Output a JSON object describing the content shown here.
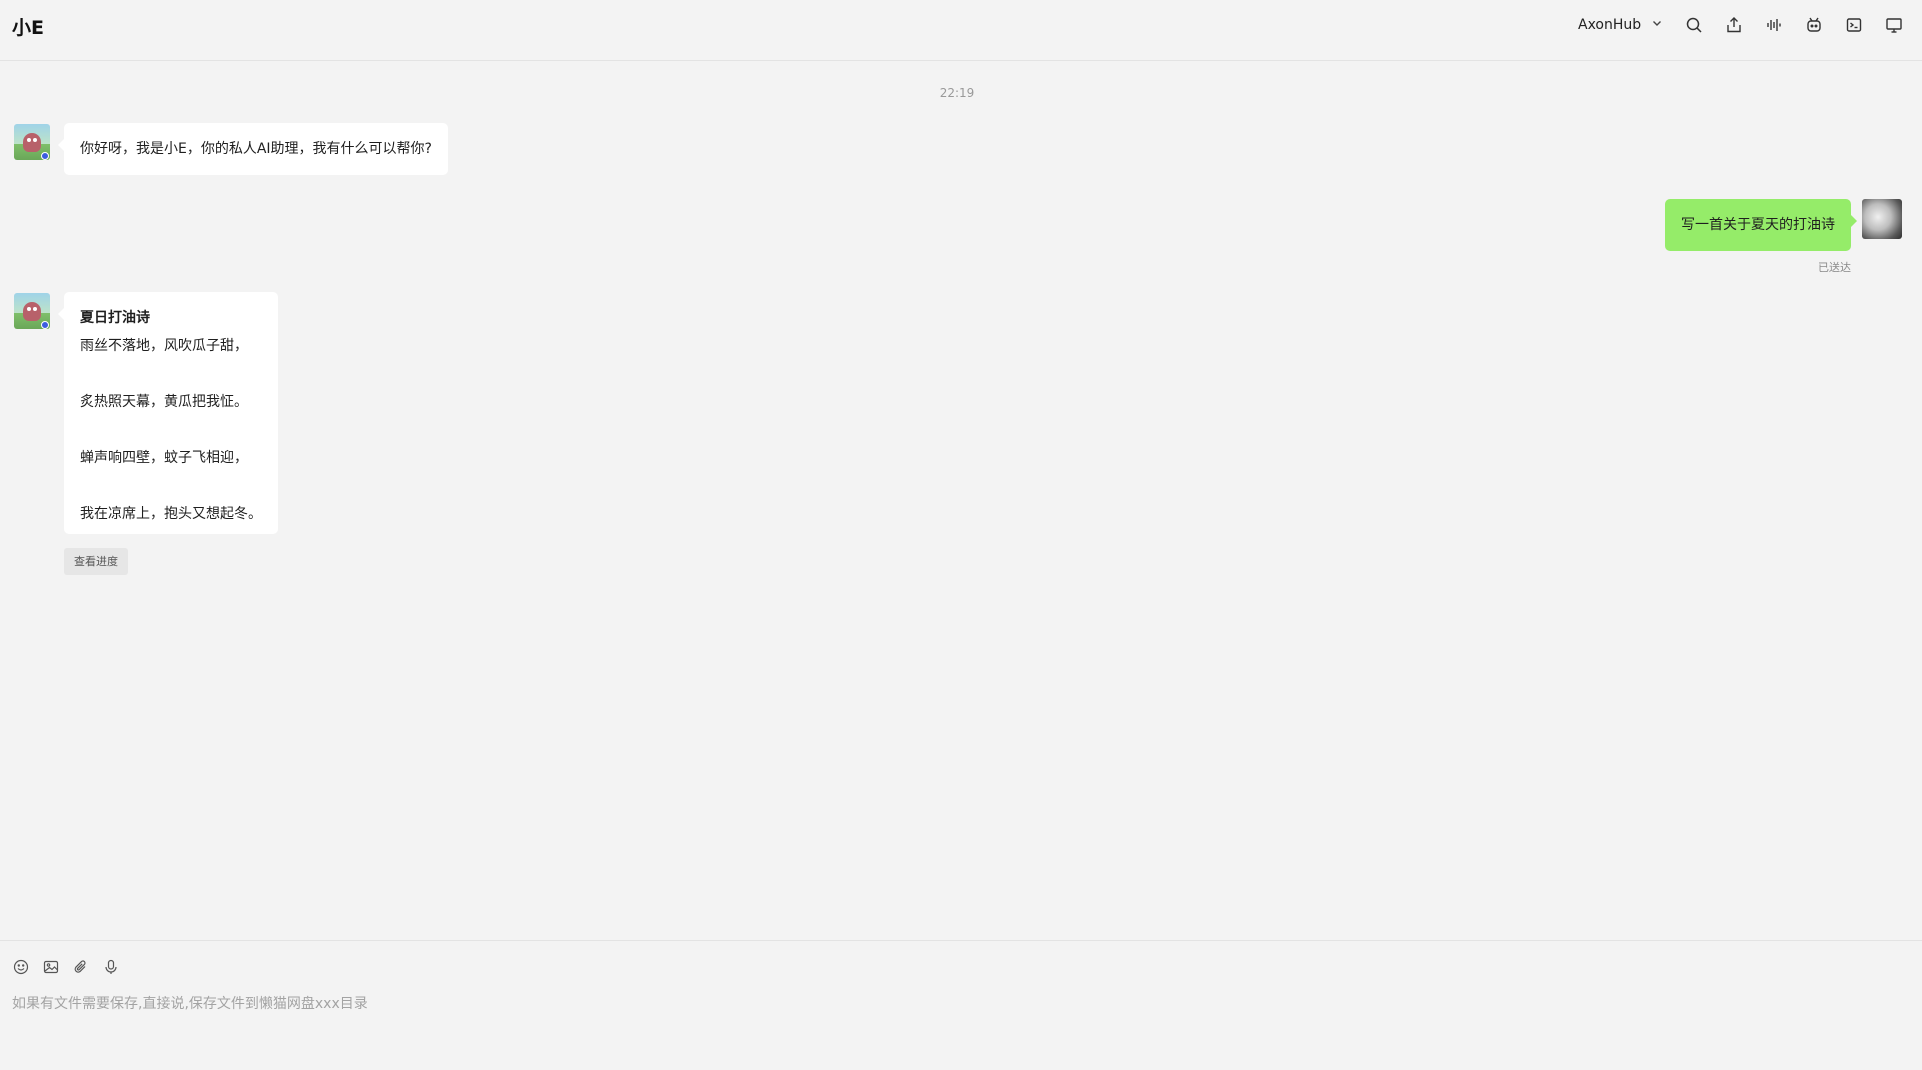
{
  "header": {
    "app_title": "小E",
    "model_selector": "AxonHub",
    "toolbar_icons": [
      "search-icon",
      "share-icon",
      "voice-wave-icon",
      "robot-icon",
      "terminal-icon",
      "monitor-icon"
    ]
  },
  "chat": {
    "timestamp": "22:19",
    "messages": [
      {
        "role": "assistant",
        "text": "你好呀，我是小E，你的私人AI助理，我有什么可以帮你?"
      },
      {
        "role": "user",
        "text": "写一首关于夏天的打油诗",
        "status": "已送达"
      },
      {
        "role": "assistant",
        "title": "夏日打油诗",
        "lines": [
          "雨丝不落地，风吹瓜子甜，",
          "炙热照天幕，黄瓜把我怔。",
          "蝉声响四壁，蚊子飞相迎，",
          "我在凉席上，抱头又想起冬。"
        ],
        "action": "查看进度"
      }
    ]
  },
  "composer": {
    "tool_icons": [
      "emoji-icon",
      "image-icon",
      "attachment-icon",
      "microphone-icon"
    ],
    "placeholder": "如果有文件需要保存,直接说,保存文件到懒猫网盘xxx目录",
    "value": ""
  },
  "colors": {
    "background": "#f3f3f3",
    "user_bubble": "#95ec69",
    "assistant_bubble": "#ffffff",
    "status_dot": "#3c5de0"
  }
}
